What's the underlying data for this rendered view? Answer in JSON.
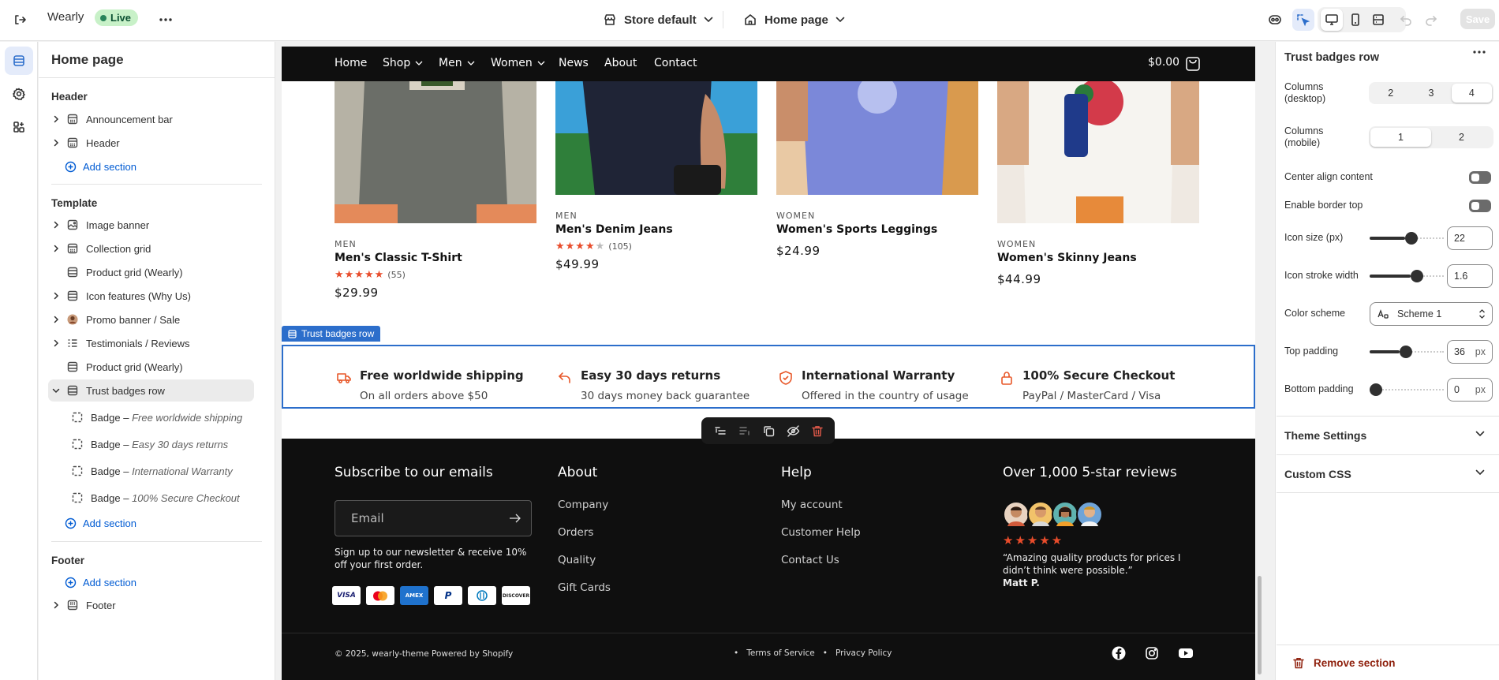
{
  "topbar": {
    "store_name": "Wearly",
    "status": "Live",
    "theme_label": "Store default",
    "page_label": "Home page",
    "save_label": "Save"
  },
  "left_panel": {
    "title": "Home page",
    "header_group": "Header",
    "header_items": [
      "Announcement bar",
      "Header"
    ],
    "add_section": "Add section",
    "template_group": "Template",
    "template_items": [
      "Image banner",
      "Collection grid",
      "Product grid (Wearly)",
      "Icon features (Why Us)",
      "Promo banner / Sale",
      "Testimonials / Reviews",
      "Product grid (Wearly)",
      "Trust badges row"
    ],
    "badge_prefix": "Badge –",
    "badge_children": [
      "Free worldwide shipping",
      "Easy 30 days returns",
      "International Warranty",
      "100% Secure Checkout"
    ],
    "footer_group": "Footer",
    "footer_items": [
      "Footer"
    ]
  },
  "store": {
    "nav": [
      "Home",
      "Shop",
      "Men",
      "Women",
      "News",
      "About",
      "Contact"
    ],
    "cart_total": "$0.00",
    "products": [
      {
        "category": "MEN",
        "name": "Men's Classic T-Shirt",
        "rating": 5,
        "reviews": "(55)",
        "price": "$29.99"
      },
      {
        "category": "MEN",
        "name": "Men's Denim Jeans",
        "rating": 4,
        "reviews": "(105)",
        "price": "$49.99"
      },
      {
        "category": "WOMEN",
        "name": "Women's Sports Leggings",
        "rating": null,
        "reviews": "",
        "price": "$24.99"
      },
      {
        "category": "WOMEN",
        "name": "Women's Skinny Jeans",
        "rating": null,
        "reviews": "",
        "price": "$44.99"
      }
    ],
    "section_tag": "Trust badges row",
    "badges": [
      {
        "title": "Free worldwide shipping",
        "subtitle": "On all orders above $50",
        "icon": "truck-icon"
      },
      {
        "title": "Easy 30 days returns",
        "subtitle": "30 days money back guarantee",
        "icon": "return-arrow-icon"
      },
      {
        "title": "International Warranty",
        "subtitle": "Offered in the country of usage",
        "icon": "shield-check-icon"
      },
      {
        "title": "100% Secure Checkout",
        "subtitle": "PayPal / MasterCard / Visa",
        "icon": "lock-icon"
      }
    ],
    "footer": {
      "subscribe_title": "Subscribe to our emails",
      "email_placeholder": "Email",
      "subscribe_text": "Sign up to our newsletter & receive 10% off your first order.",
      "payment_methods": [
        "VISA",
        "MC",
        "AMEX",
        "PP",
        "DC",
        "DISCOVER"
      ],
      "about_title": "About",
      "about_links": [
        "Company",
        "Orders",
        "Quality",
        "Gift Cards"
      ],
      "help_title": "Help",
      "help_links": [
        "My account",
        "Customer Help",
        "Contact Us"
      ],
      "reviews_title": "Over 1,000 5-star reviews",
      "review_quote": "“Amazing quality products for prices I didn’t think were possible.”",
      "review_author": "Matt P.",
      "copyright": "© 2025, wearly-theme Powered by Shopify",
      "legal_links": [
        "Terms of Service",
        "Privacy Policy"
      ]
    }
  },
  "settings": {
    "title": "Trust badges row",
    "columns_desktop_label": "Columns (desktop)",
    "columns_desktop_options": [
      "2",
      "3",
      "4"
    ],
    "columns_desktop_selected": "4",
    "columns_mobile_label": "Columns (mobile)",
    "columns_mobile_options": [
      "1",
      "2"
    ],
    "columns_mobile_selected": "1",
    "center_align_label": "Center align content",
    "center_align_on": false,
    "border_top_label": "Enable border top",
    "border_top_on": false,
    "icon_size_label": "Icon size (px)",
    "icon_size_value": "22",
    "icon_size_fraction": 0.48,
    "icon_stroke_label": "Icon stroke width",
    "icon_stroke_value": "1.6",
    "icon_stroke_fraction": 0.55,
    "color_scheme_label": "Color scheme",
    "color_scheme_value": "Scheme 1",
    "top_padding_label": "Top padding",
    "top_padding_value": "36",
    "top_padding_fraction": 0.4,
    "bottom_padding_label": "Bottom padding",
    "bottom_padding_value": "0",
    "bottom_padding_fraction": 0.0,
    "unit": "px",
    "theme_settings_label": "Theme Settings",
    "custom_css_label": "Custom CSS",
    "remove_label": "Remove section"
  },
  "colors": {
    "accent": "#2c6ecb",
    "live_bg": "#c8f1c8",
    "star": "#e84c2b",
    "danger": "#8e1f0b"
  }
}
